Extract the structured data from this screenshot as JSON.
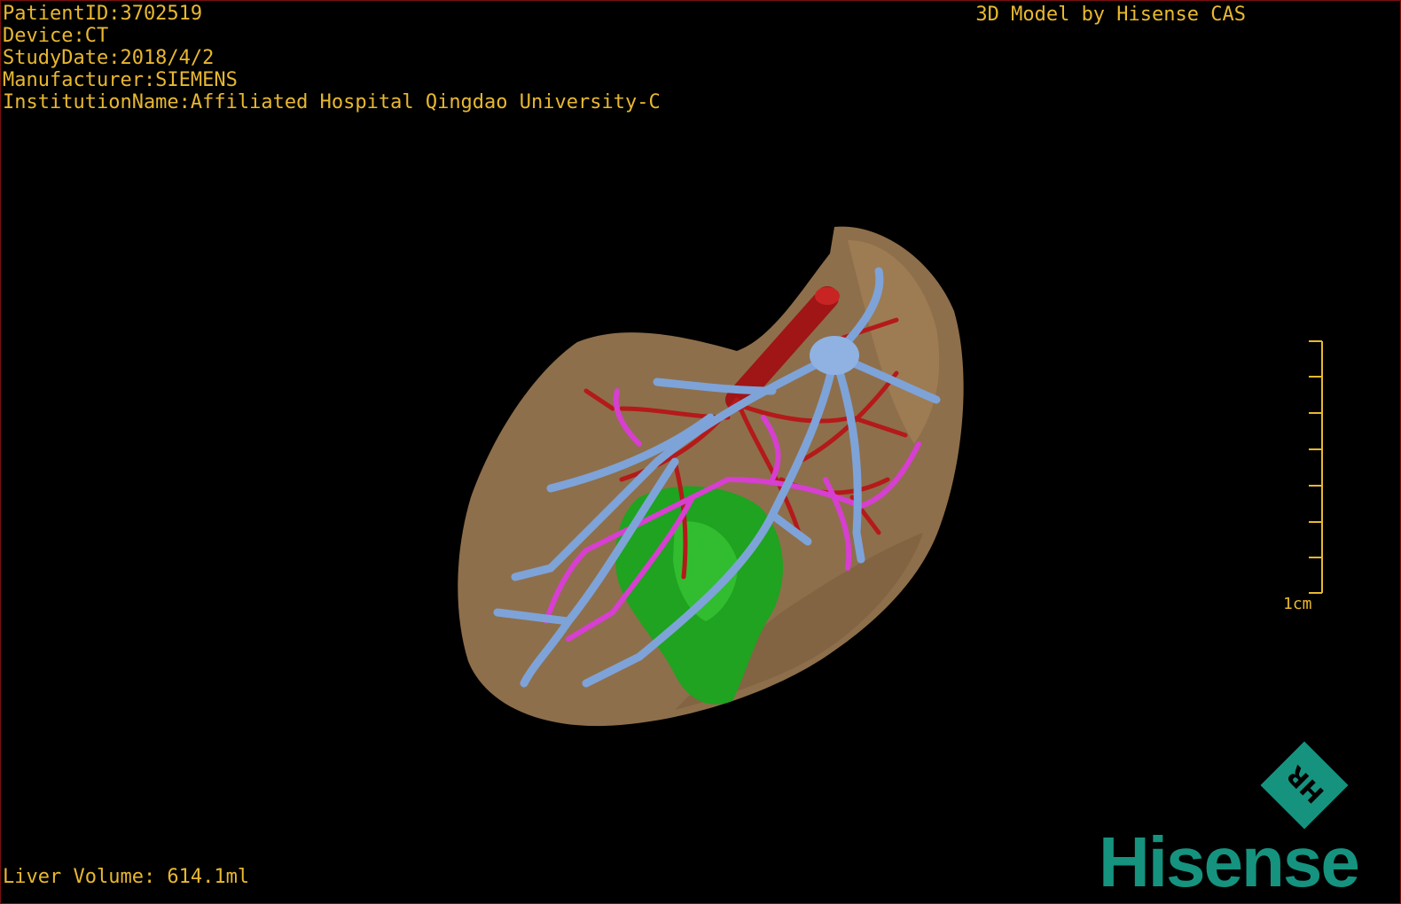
{
  "metadata": {
    "patient_id": "PatientID:3702519",
    "device": "Device:CT",
    "study_date": "StudyDate:2018/4/2",
    "manufacturer": "Manufacturer:SIEMENS",
    "institution": "InstitutionName:Affiliated Hospital Qingdao University-C"
  },
  "brand_caption": "3D Model by Hisense CAS",
  "liver_volume": "Liver Volume: 614.1ml",
  "scale_bar": {
    "label": "1cm"
  },
  "logo": {
    "word": "Hisense",
    "badge": "HR"
  },
  "colors": {
    "overlay_text": "#e8b830",
    "liver": "#8e6f4b",
    "hepatic_vein": "#7ea3d8",
    "portal_vein": "#d63fd0",
    "artery": "#b41a1a",
    "tumor": "#1fa320",
    "logo": "#15937f"
  }
}
